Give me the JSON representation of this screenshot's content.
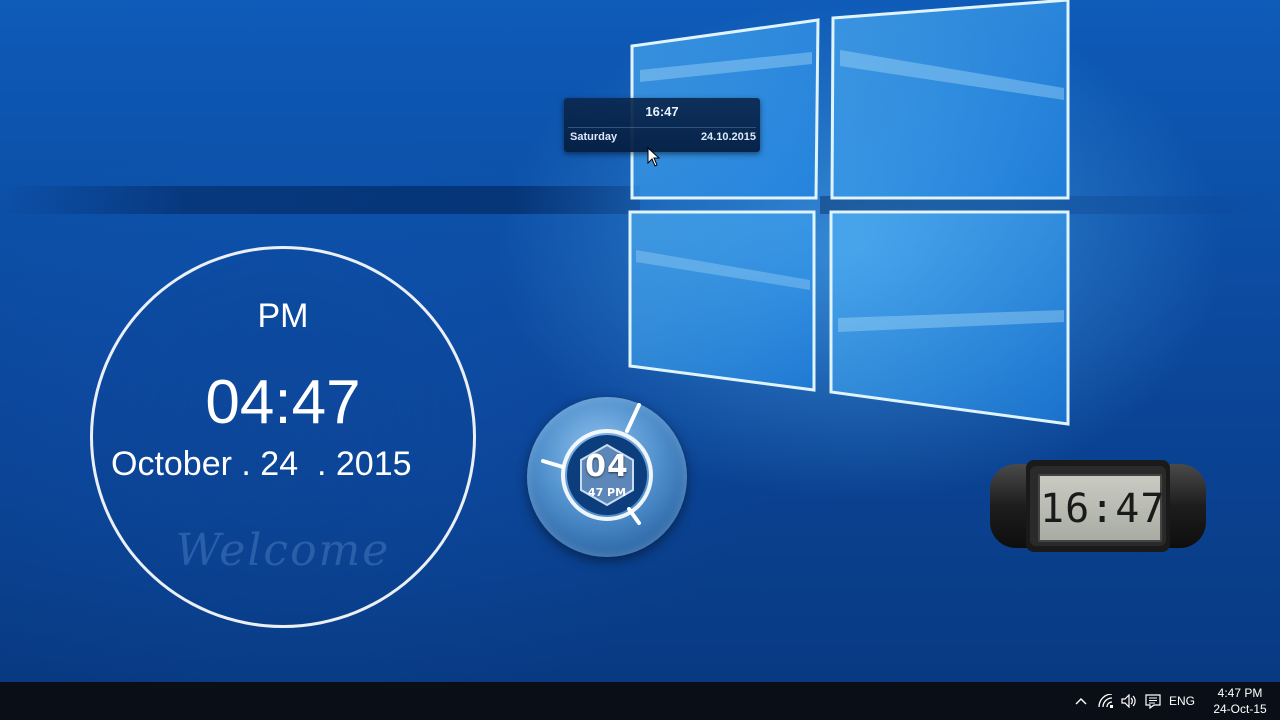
{
  "desktop": {
    "tooltip_clock": {
      "time": "16:47",
      "day": "Saturday",
      "date": "24.10.2015"
    },
    "circle_clock": {
      "ampm": "PM",
      "time": "04:47",
      "date": "October . 24  . 2015",
      "watermark": "Welcome"
    },
    "orb_clock": {
      "hour": "04",
      "minute_ampm": "47 PM"
    },
    "lcd_clock": {
      "time": "16:47"
    }
  },
  "taskbar": {
    "tray_icons": [
      "chevron-up-icon",
      "wifi-icon",
      "speaker-icon",
      "action-center-icon"
    ],
    "language": "ENG",
    "clock": {
      "time": "4:47 PM",
      "date": "24-Oct-15"
    }
  },
  "colors": {
    "desktop_blue": "#0c4ea5",
    "taskbar": "#0a0f17",
    "logo_glow": "#7fd0ff"
  }
}
